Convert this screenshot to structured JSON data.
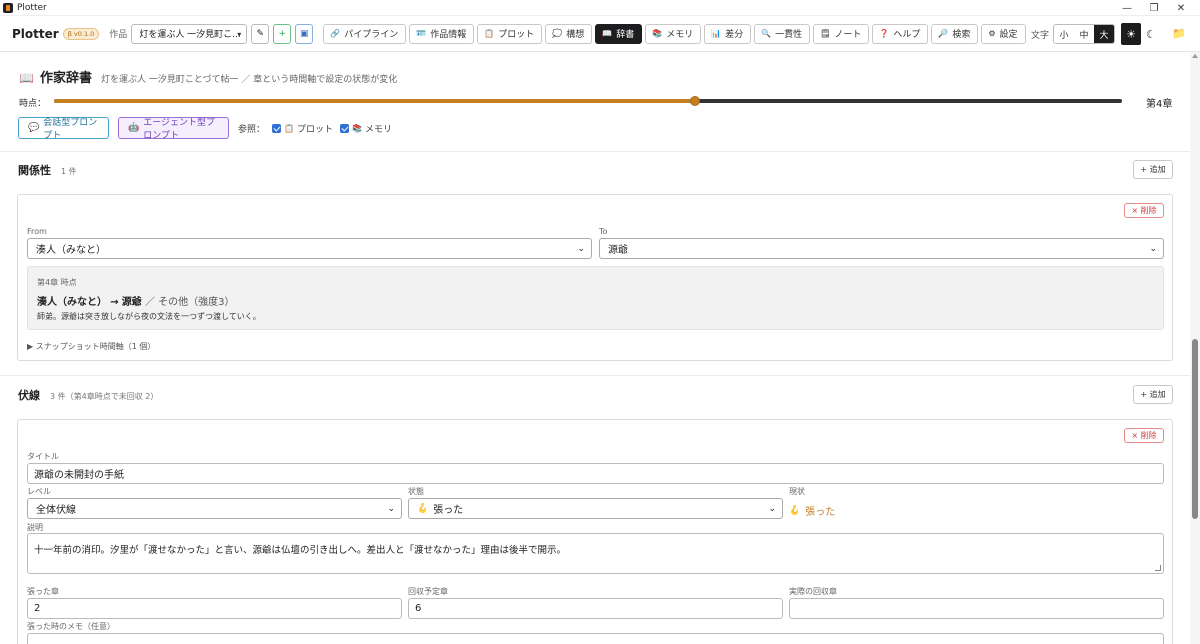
{
  "window": {
    "title": "Plotter",
    "minimize": "—",
    "maximize": "❐",
    "close": "✕"
  },
  "toolbar": {
    "brand": "Plotter",
    "version": "β v0.1.0",
    "work_label": "作品",
    "work_value": "灯を運ぶ人 一汐見町こ...",
    "nav": [
      {
        "label": "パイプライン",
        "icon": "🔗"
      },
      {
        "label": "作品情報",
        "icon": "🪪"
      },
      {
        "label": "プロット",
        "icon": "📋"
      },
      {
        "label": "構想",
        "icon": "💭"
      },
      {
        "label": "辞書",
        "icon": "📖"
      },
      {
        "label": "メモリ",
        "icon": "📚"
      },
      {
        "label": "差分",
        "icon": "📊"
      },
      {
        "label": "一貫性",
        "icon": "🔍"
      },
      {
        "label": "ノート",
        "icon": "🗒"
      },
      {
        "label": "ヘルプ",
        "icon": "❓"
      },
      {
        "label": "検索",
        "icon": "🔎"
      },
      {
        "label": "設定",
        "icon": "⚙"
      }
    ],
    "active_nav": "辞書",
    "font_label": "文字",
    "font_sizes": [
      "小",
      "中",
      "大"
    ],
    "font_size_active": "大",
    "theme_light": "☀",
    "theme_dark": "☾"
  },
  "header": {
    "title": "作家辞書",
    "subtitle": "灯を運ぶ人 一汐見町ことづて帖一 ／ 章という時間軸で設定の状態が変化",
    "timeline_label": "時点：",
    "timeline_value": "第4章",
    "timeline_progress": 0.6,
    "conv_prompt": "会話型プロンプト",
    "agent_prompt": "エージェント型プロンプト",
    "ref_label": "参照：",
    "ref_plot": "プロット",
    "ref_memory": "メモリ"
  },
  "relations": {
    "title": "関係性",
    "count": "1 件",
    "add_label": "+ 追加",
    "delete_label": "× 削除",
    "from_label": "From",
    "from_value": "湊人（みなと）",
    "to_label": "To",
    "to_value": "源爺",
    "snapshot_chapter": "第4章 時点",
    "snapshot_from": "湊人（みなと）",
    "snapshot_arrow": "→",
    "snapshot_to": "源爺",
    "snapshot_kind": "／ その他（強度3）",
    "snapshot_desc": "師弟。源爺は突き放しながら夜の文法を一つずつ渡していく。",
    "timeline_toggle": "▶ スナップショット時間軸（1 個）"
  },
  "foreshadow": {
    "title": "伏線",
    "count": "3 件（第4章時点で未回収 2）",
    "add_label": "+ 追加",
    "delete_label": "× 削除",
    "title_label": "タイトル",
    "title_value": "源爺の未開封の手紙",
    "level_label": "レベル",
    "level_value": "全体伏線",
    "state_label": "状態",
    "state_value": "張った",
    "state_icon": "🪝",
    "current_label": "現状",
    "current_value": "張った",
    "desc_label": "説明",
    "desc_value": "十一年前の消印。汐里が「渡せなかった」と言い、源爺は仏壇の引き出しへ。差出人と「渡せなかった」理由は後半で開示。",
    "planted_label": "張った章",
    "planted_value": "2",
    "planned_label": "回収予定章",
    "planned_value": "6",
    "actual_label": "実際の回収章",
    "actual_value": "",
    "memo_label": "張った時のメモ（任意）"
  }
}
